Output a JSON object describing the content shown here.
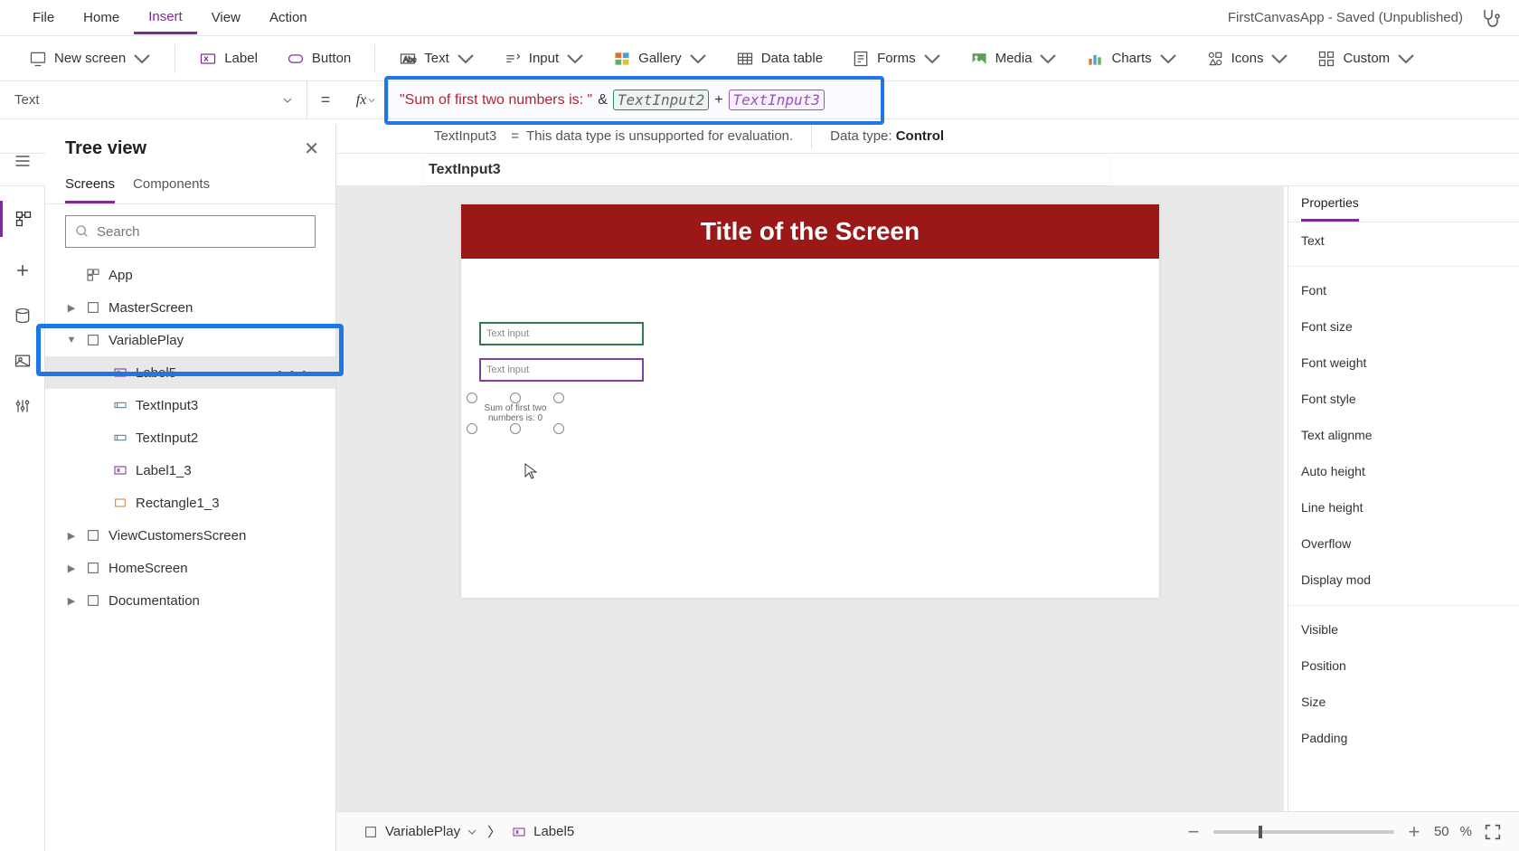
{
  "menubar": {
    "items": [
      "File",
      "Home",
      "Insert",
      "View",
      "Action"
    ],
    "active": "Insert",
    "app_title": "FirstCanvasApp - Saved (Unpublished)"
  },
  "ribbon": {
    "new_screen": "New screen",
    "label": "Label",
    "button": "Button",
    "text": "Text",
    "input": "Input",
    "gallery": "Gallery",
    "data_table": "Data table",
    "forms": "Forms",
    "media": "Media",
    "charts": "Charts",
    "icons": "Icons",
    "custom": "Custom"
  },
  "formula": {
    "property": "Text",
    "string_part": "\"Sum of first two numbers is: \"",
    "amp": "&",
    "token1": "TextInput2",
    "plus": "+",
    "token2": "TextInput3"
  },
  "info_bar": {
    "expr": "TextInput3",
    "msg": "This data type is unsupported for evaluation.",
    "data_type_label": "Data type:",
    "data_type_value": "Control"
  },
  "intellisense": {
    "suggestion": "TextInput3"
  },
  "tree": {
    "title": "Tree view",
    "tabs": {
      "screens": "Screens",
      "components": "Components"
    },
    "search_placeholder": "Search",
    "app": "App",
    "nodes": {
      "master": "MasterScreen",
      "variable_play": "VariablePlay",
      "label5": "Label5",
      "textinput3": "TextInput3",
      "textinput2": "TextInput2",
      "label1_3": "Label1_3",
      "rectangle1_3": "Rectangle1_3",
      "view_customers": "ViewCustomersScreen",
      "home": "HomeScreen",
      "documentation": "Documentation"
    }
  },
  "canvas": {
    "screen_title": "Title of the Screen",
    "placeholder1": "Text input",
    "placeholder2": "Text input",
    "label_text_l1": "Sum of first two",
    "label_text_l2": "numbers is: 0"
  },
  "properties": {
    "tab": "Properties",
    "rows": {
      "text": "Text",
      "font": "Font",
      "font_size": "Font size",
      "font_weight": "Font weight",
      "font_style": "Font style",
      "text_align": "Text alignme",
      "auto_height": "Auto height",
      "line_height": "Line height",
      "overflow": "Overflow",
      "display_mode": "Display mod",
      "visible": "Visible",
      "position": "Position",
      "size": "Size",
      "padding": "Padding"
    }
  },
  "status": {
    "screen_name": "VariablePlay",
    "control_name": "Label5",
    "zoom_pct": "50",
    "pct_sym": "%"
  }
}
